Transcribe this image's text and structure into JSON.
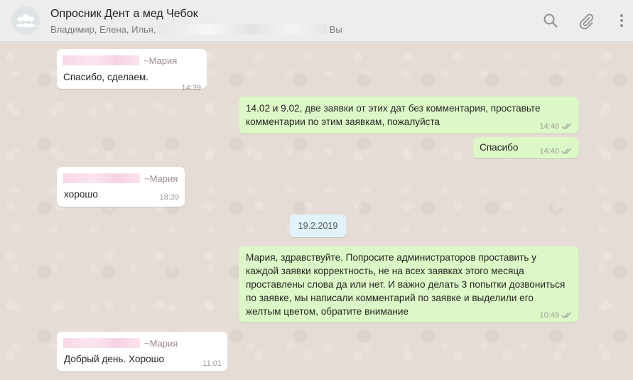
{
  "header": {
    "title": "Опросник Дент а мед Чебок",
    "participants_prefix": "Владимир, Елена, Илья,",
    "participants_suffix": "Вы",
    "avatar_icon": "group-avatar-icon",
    "search_icon": "search-icon",
    "attach_icon": "paperclip-icon",
    "menu_icon": "kebab-menu-icon"
  },
  "messages": [
    {
      "dir": "in",
      "sender": "~Мария",
      "text": "Спасибо, сделаем.",
      "time": "14:39"
    },
    {
      "dir": "out",
      "text": "14.02 и 9.02, две заявки от этих дат без комментария, проставьте комментарии по этим заявкам, пожалуйста",
      "time": "14:40"
    },
    {
      "dir": "out",
      "text": "Спасибо",
      "time": "14:40"
    },
    {
      "dir": "in",
      "sender": "~Мария",
      "text": "хорошо",
      "time": "18:39"
    },
    {
      "dir": "out",
      "text": "Мария, здравствуйте. Попросите администраторов проставить у каждой заявки корректность, не на всех заявках этого месяца проставлены слова да или нет. И важно делать 3 попытки дозвониться по заявке, мы написали комментарий по заявке и выделили его желтым цветом, обратите внимание",
      "time": "10:49"
    },
    {
      "dir": "in",
      "sender": "~Мария",
      "text": "Добрый день. Хорошо",
      "time": "11:01"
    }
  ],
  "date_separator": "19.2.2019",
  "colors": {
    "incoming_bubble": "#ffffff",
    "outgoing_bubble": "#dcf8c6",
    "chat_background": "#e5ddd5",
    "date_pill": "#e1f3fb",
    "read_ticks": "#a0a0a0"
  }
}
